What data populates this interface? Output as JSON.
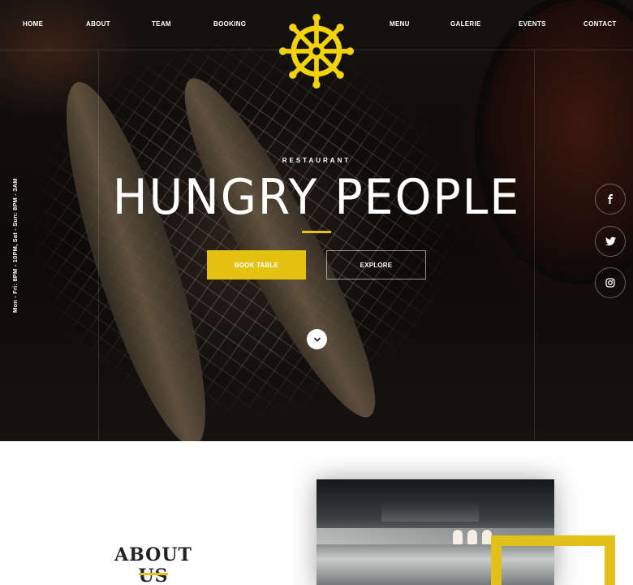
{
  "nav": {
    "left": [
      "HOME",
      "ABOUT",
      "TEAM",
      "BOOKING"
    ],
    "right": [
      "MENU",
      "GALERIE",
      "EVENTS",
      "CONTACT"
    ]
  },
  "logo": {
    "icon": "ship-wheel-icon",
    "color": "#f2d30a"
  },
  "hero": {
    "subtitle": "RESTAURANT",
    "title": "HUNGRY PEOPLE",
    "book_button": "BOOK TABLE",
    "explore_button": "EXPLORE",
    "hours": "Mon - Fri: 8PM - 10PM, Sat - Sun: 8PM - 3AM",
    "accent": "#e4c212"
  },
  "social": [
    "facebook-icon",
    "twitter-icon",
    "instagram-icon"
  ],
  "about": {
    "title": "ABOUT US"
  }
}
